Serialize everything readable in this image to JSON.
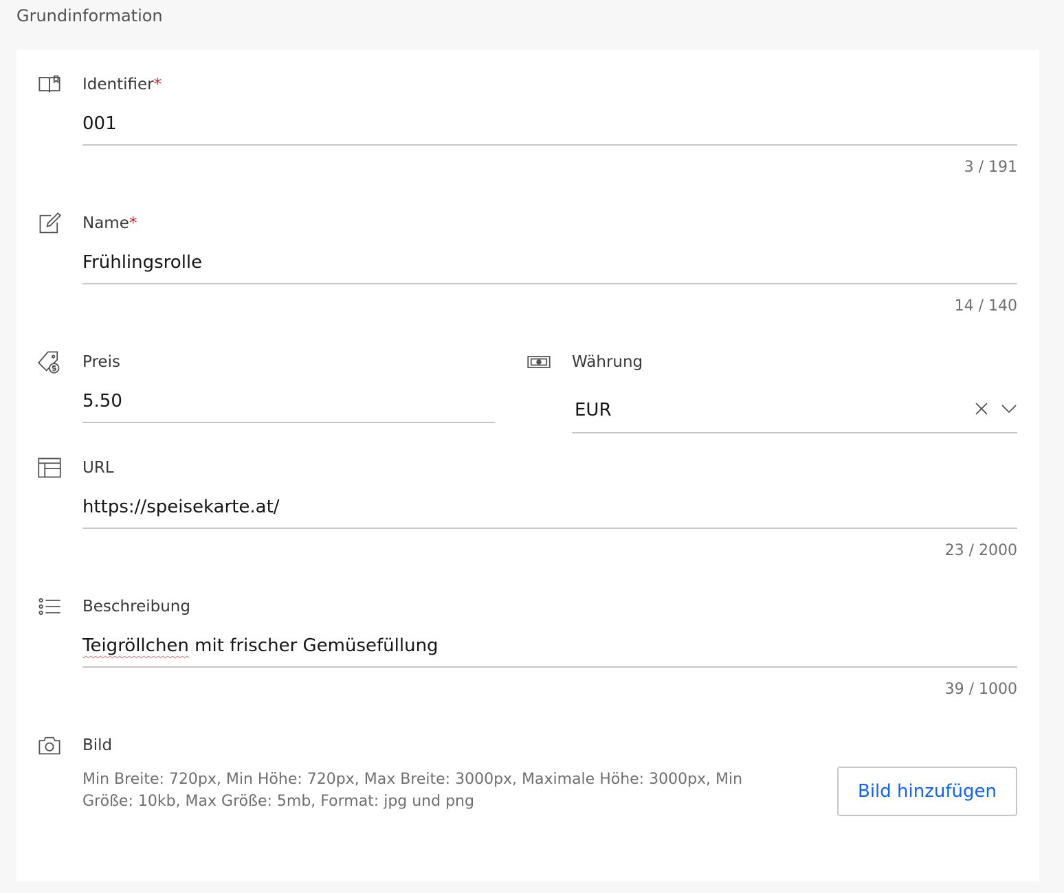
{
  "section": {
    "title": "Grundinformation"
  },
  "fields": {
    "identifier": {
      "label": "Identifier",
      "required": "*",
      "value": "001",
      "counter": "3 / 191",
      "icon": "book-icon"
    },
    "name": {
      "label": "Name",
      "required": "*",
      "value": "Frühlingsrolle",
      "counter": "14 / 140",
      "icon": "edit-icon"
    },
    "price": {
      "label": "Preis",
      "value": "5.50",
      "icon": "price-tag-icon"
    },
    "currency": {
      "label": "Währung",
      "value": "EUR",
      "icon": "money-icon"
    },
    "url": {
      "label": "URL",
      "value": "https://speisekarte.at/",
      "counter": "23 / 2000",
      "icon": "layout-icon"
    },
    "description": {
      "label": "Beschreibung",
      "value_misspelled": "Teigröllchen",
      "value_rest": " mit frischer Gemüsefüllung",
      "counter": "39 / 1000",
      "icon": "list-icon"
    },
    "image": {
      "label": "Bild",
      "hint": "Min Breite: 720px, Min Höhe: 720px, Max Breite: 3000px, Maximale Höhe: 3000px, Min Größe: 10kb, Max Größe: 5mb, Format: jpg und png",
      "button_label": "Bild hinzufügen",
      "icon": "camera-icon"
    }
  },
  "colors": {
    "accent": "#0f62fe",
    "required": "#da1e28",
    "border": "#c6c6c6",
    "background": "#f7f7f7"
  }
}
